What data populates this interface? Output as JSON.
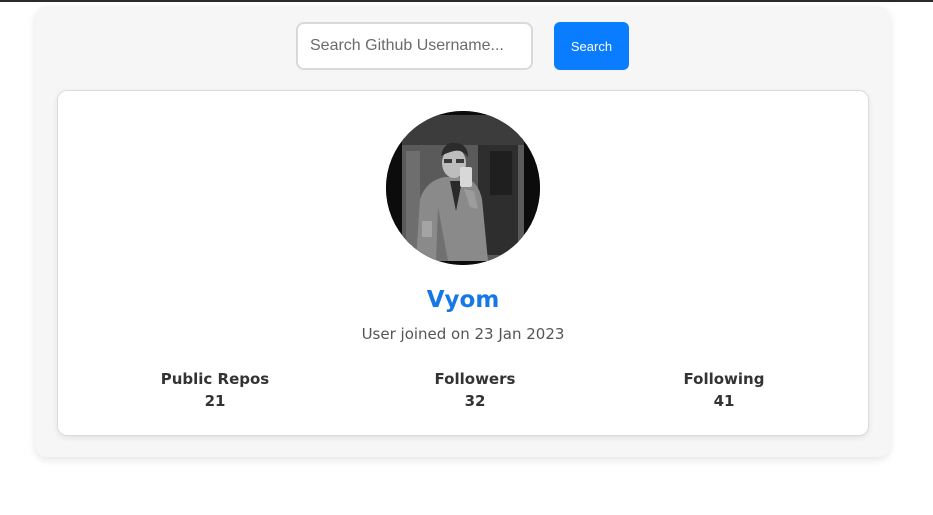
{
  "search": {
    "placeholder": "Search Github Username...",
    "button_label": "Search"
  },
  "profile": {
    "name": "Vyom",
    "joined": "User joined on 23 Jan 2023",
    "avatar_icon": "user-photo",
    "stats": {
      "repos": {
        "label": "Public Repos",
        "value": "21"
      },
      "followers": {
        "label": "Followers",
        "value": "32"
      },
      "following": {
        "label": "Following",
        "value": "41"
      }
    }
  },
  "colors": {
    "accent": "#0a7cff",
    "name": "#1677e6",
    "panel": "#f6f6f6",
    "card": "#ffffff"
  }
}
